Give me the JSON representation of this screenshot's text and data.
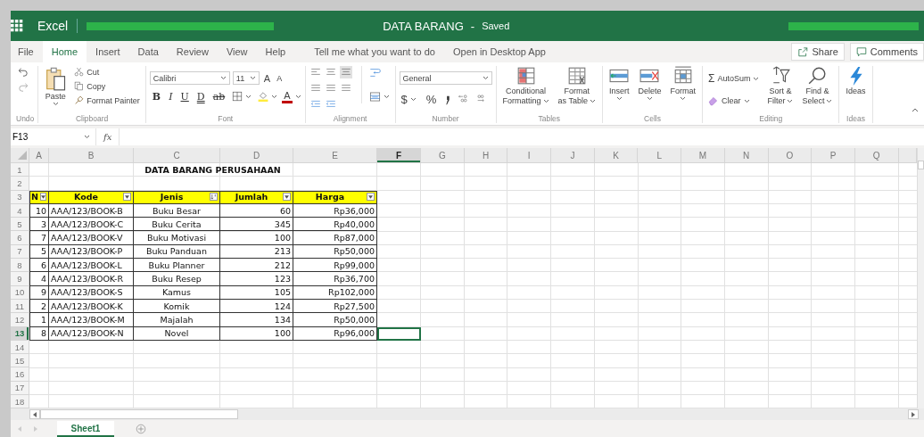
{
  "title_bar": {
    "app_name": "Excel",
    "document": "DATA BARANG",
    "separator": "-",
    "status": "Saved"
  },
  "menu": {
    "tabs": [
      {
        "label": "File",
        "selected": false
      },
      {
        "label": "Home",
        "selected": true
      },
      {
        "label": "Insert",
        "selected": false
      },
      {
        "label": "Data",
        "selected": false
      },
      {
        "label": "Review",
        "selected": false
      },
      {
        "label": "View",
        "selected": false
      },
      {
        "label": "Help",
        "selected": false
      }
    ],
    "search": "Tell me what you want to do",
    "desktop": "Open in Desktop App",
    "share": "Share",
    "comments": "Comments"
  },
  "ribbon": {
    "groups": [
      {
        "kind": "undo",
        "label": "Undo"
      },
      {
        "kind": "clipboard",
        "label": "Clipboard",
        "paste": "Paste",
        "cut": "Cut",
        "copy": "Copy",
        "painter": "Format Painter"
      },
      {
        "kind": "font",
        "label": "Font",
        "font_name": "Calibri",
        "font_size": "11",
        "grow": "A",
        "shrink": "A",
        "styles": [
          "B",
          "I",
          "U",
          "D",
          "ab"
        ],
        "font_color": "A"
      },
      {
        "kind": "alignment",
        "label": "Alignment"
      },
      {
        "kind": "number",
        "label": "Number",
        "format": "General",
        "currency": "$",
        "percent": "%"
      },
      {
        "kind": "buttons",
        "label": "Tables",
        "buttons": [
          {
            "kind": "conditional",
            "lines": [
              "Conditional",
              "Formatting"
            ],
            "dropdown": true
          },
          {
            "kind": "table",
            "lines": [
              "Format",
              "as Table"
            ],
            "dropdown": true
          }
        ]
      },
      {
        "kind": "buttons",
        "label": "Cells",
        "buttons": [
          {
            "kind": "insert",
            "lines": [
              "Insert"
            ],
            "dropdown": true
          },
          {
            "kind": "delete",
            "lines": [
              "Delete"
            ],
            "dropdown": true
          },
          {
            "kind": "format",
            "lines": [
              "Format"
            ],
            "dropdown": true
          }
        ]
      },
      {
        "kind": "editing",
        "label": "Editing",
        "sigma": "Σ",
        "autosum": "AutoSum",
        "clear": "Clear",
        "buttons": [
          {
            "kind": "sort",
            "lines": [
              "Sort &",
              "Filter"
            ],
            "dropdown": true
          },
          {
            "kind": "find",
            "lines": [
              "Find &",
              "Select"
            ],
            "dropdown": true
          }
        ]
      },
      {
        "kind": "buttons",
        "label": "Ideas",
        "buttons": [
          {
            "kind": "ideas",
            "lines": [
              "Ideas"
            ],
            "dropdown": false
          }
        ]
      }
    ]
  },
  "formula_bar": {
    "name_box": "F13",
    "function_label": "fx"
  },
  "sheet": {
    "columns": [
      {
        "label": "A",
        "selected": false
      },
      {
        "label": "B",
        "selected": false
      },
      {
        "label": "C",
        "selected": false
      },
      {
        "label": "D",
        "selected": false
      },
      {
        "label": "E",
        "selected": false
      },
      {
        "label": "F",
        "selected": true
      },
      {
        "label": "G",
        "selected": false
      },
      {
        "label": "H",
        "selected": false
      },
      {
        "label": "I",
        "selected": false
      },
      {
        "label": "J",
        "selected": false
      },
      {
        "label": "K",
        "selected": false
      },
      {
        "label": "L",
        "selected": false
      },
      {
        "label": "M",
        "selected": false
      },
      {
        "label": "N",
        "selected": false
      },
      {
        "label": "O",
        "selected": false
      },
      {
        "label": "P",
        "selected": false
      },
      {
        "label": "Q",
        "selected": false
      }
    ],
    "rows": [
      {
        "number": "1",
        "selected": false,
        "kind": "title",
        "text": "DATA BARANG PERUSAHAAN"
      },
      {
        "number": "2",
        "selected": false,
        "kind": "blank"
      },
      {
        "number": "3",
        "selected": false,
        "kind": "header",
        "cells": [
          {
            "label": "N",
            "sorted": false
          },
          {
            "label": "Kode",
            "sorted": false
          },
          {
            "label": "Jenis",
            "sorted": true
          },
          {
            "label": "Jumlah",
            "sorted": false
          },
          {
            "label": "Harga",
            "sorted": false
          }
        ]
      },
      {
        "number": "4",
        "selected": false,
        "kind": "record",
        "cells": [
          "10",
          "AAA/123/BOOK-B",
          "Buku Besar",
          "60",
          "Rp36,000"
        ]
      },
      {
        "number": "5",
        "selected": false,
        "kind": "record",
        "cells": [
          "3",
          "AAA/123/BOOK-C",
          "Buku Cerita",
          "345",
          "Rp40,000"
        ]
      },
      {
        "number": "6",
        "selected": false,
        "kind": "record",
        "cells": [
          "7",
          "AAA/123/BOOK-V",
          "Buku Motivasi",
          "100",
          "Rp87,000"
        ]
      },
      {
        "number": "7",
        "selected": false,
        "kind": "record",
        "cells": [
          "5",
          "AAA/123/BOOK-P",
          "Buku Panduan",
          "213",
          "Rp50,000"
        ]
      },
      {
        "number": "8",
        "selected": false,
        "kind": "record",
        "cells": [
          "6",
          "AAA/123/BOOK-L",
          "Buku Planner",
          "212",
          "Rp99,000"
        ]
      },
      {
        "number": "9",
        "selected": false,
        "kind": "record",
        "cells": [
          "4",
          "AAA/123/BOOK-R",
          "Buku Resep",
          "123",
          "Rp36,700"
        ]
      },
      {
        "number": "10",
        "selected": false,
        "kind": "record",
        "cells": [
          "9",
          "AAA/123/BOOK-S",
          "Kamus",
          "105",
          "Rp102,000"
        ]
      },
      {
        "number": "11",
        "selected": false,
        "kind": "record",
        "cells": [
          "2",
          "AAA/123/BOOK-K",
          "Komik",
          "124",
          "Rp27,500"
        ]
      },
      {
        "number": "12",
        "selected": false,
        "kind": "record",
        "cells": [
          "1",
          "AAA/123/BOOK-M",
          "Majalah",
          "134",
          "Rp50,000"
        ]
      },
      {
        "number": "13",
        "selected": true,
        "kind": "record",
        "cells": [
          "8",
          "AAA/123/BOOK-N",
          "Novel",
          "100",
          "Rp96,000"
        ]
      },
      {
        "number": "14",
        "selected": false,
        "kind": "blank"
      },
      {
        "number": "15",
        "selected": false,
        "kind": "blank"
      },
      {
        "number": "16",
        "selected": false,
        "kind": "blank"
      },
      {
        "number": "17",
        "selected": false,
        "kind": "blank"
      },
      {
        "number": "18",
        "selected": false,
        "kind": "blank"
      }
    ]
  },
  "sheet_tabs": [
    {
      "label": "Sheet1",
      "selected": true
    }
  ]
}
